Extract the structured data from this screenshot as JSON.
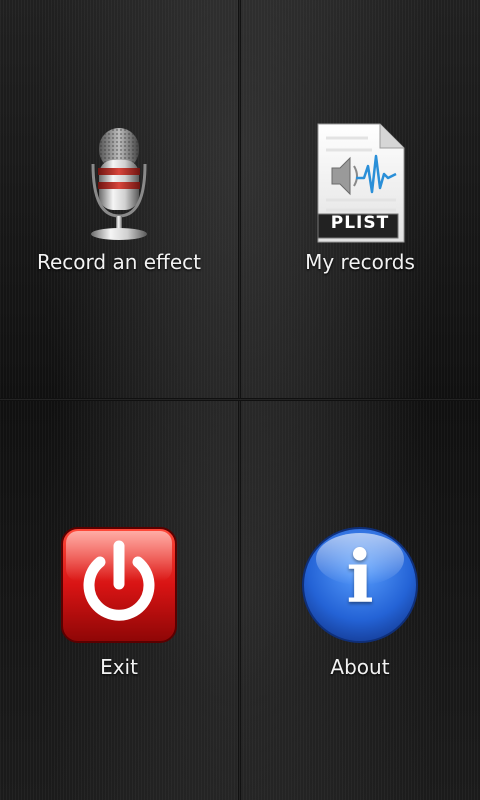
{
  "menu": {
    "record": {
      "label": "Record an effect",
      "icon": "microphone-icon"
    },
    "records": {
      "label": "My records",
      "icon": "plist-file-icon",
      "badge": "PLIST"
    },
    "exit": {
      "label": "Exit",
      "icon": "power-icon"
    },
    "about": {
      "label": "About",
      "icon": "info-icon",
      "glyph": "i"
    }
  },
  "colors": {
    "power_red": "#d01010",
    "info_blue": "#2a6fe0",
    "mic_band": "#c0302a"
  }
}
